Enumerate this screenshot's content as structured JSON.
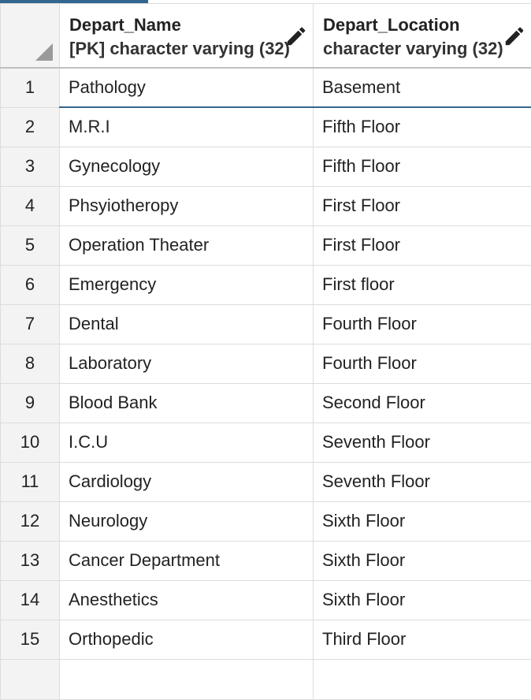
{
  "columns": [
    {
      "name": "Depart_Name",
      "type": "[PK] character varying (32)"
    },
    {
      "name": "Depart_Location",
      "type": "character varying (32)"
    }
  ],
  "rows": [
    {
      "num": "1",
      "name": "Pathology",
      "location": "Basement"
    },
    {
      "num": "2",
      "name": "M.R.I",
      "location": "Fifth Floor"
    },
    {
      "num": "3",
      "name": "Gynecology",
      "location": "Fifth Floor"
    },
    {
      "num": "4",
      "name": "Phsyiotheropy",
      "location": "First Floor"
    },
    {
      "num": "5",
      "name": "Operation Theater",
      "location": "First Floor"
    },
    {
      "num": "6",
      "name": "Emergency",
      "location": "First floor"
    },
    {
      "num": "7",
      "name": "Dental",
      "location": "Fourth Floor"
    },
    {
      "num": "8",
      "name": "Laboratory",
      "location": "Fourth Floor"
    },
    {
      "num": "9",
      "name": "Blood Bank",
      "location": "Second Floor"
    },
    {
      "num": "10",
      "name": "I.C.U",
      "location": "Seventh Floor"
    },
    {
      "num": "11",
      "name": "Cardiology",
      "location": "Seventh Floor"
    },
    {
      "num": "12",
      "name": "Neurology",
      "location": "Sixth Floor"
    },
    {
      "num": "13",
      "name": "Cancer Department",
      "location": "Sixth Floor"
    },
    {
      "num": "14",
      "name": "Anesthetics",
      "location": "Sixth Floor"
    },
    {
      "num": "15",
      "name": "Orthopedic",
      "location": "Third Floor"
    }
  ],
  "icons": {
    "edit": "pencil-icon",
    "select_all": "select-all-corner-icon"
  },
  "colors": {
    "accent": "#326690",
    "header_bg": "#f3f3f3",
    "grid_line": "#dcdcdc"
  }
}
